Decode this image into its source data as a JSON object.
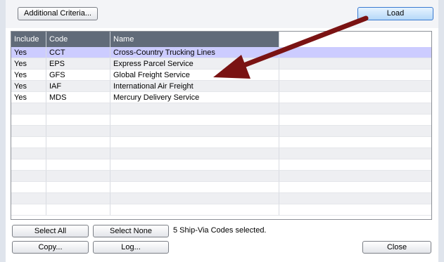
{
  "toolbar": {
    "additional_criteria_label": "Additional Criteria...",
    "load_label": "Load"
  },
  "grid": {
    "columns": [
      "Include",
      "Code",
      "Name"
    ],
    "rows": [
      {
        "include": "Yes",
        "code": "CCT",
        "name": "Cross-Country Trucking Lines"
      },
      {
        "include": "Yes",
        "code": "EPS",
        "name": "Express Parcel Service"
      },
      {
        "include": "Yes",
        "code": "GFS",
        "name": "Global Freight Service"
      },
      {
        "include": "Yes",
        "code": "IAF",
        "name": "International Air Freight"
      },
      {
        "include": "Yes",
        "code": "MDS",
        "name": "Mercury Delivery Service"
      }
    ],
    "selected_row_index": 0
  },
  "footer": {
    "select_all_label": "Select All",
    "select_none_label": "Select None",
    "status_text": "5 Ship-Via Codes selected.",
    "copy_label": "Copy...",
    "log_label": "Log...",
    "close_label": "Close"
  },
  "annotation": {
    "arrow_color": "#7a1313",
    "arrow_icon": "pointer-arrow-icon"
  }
}
